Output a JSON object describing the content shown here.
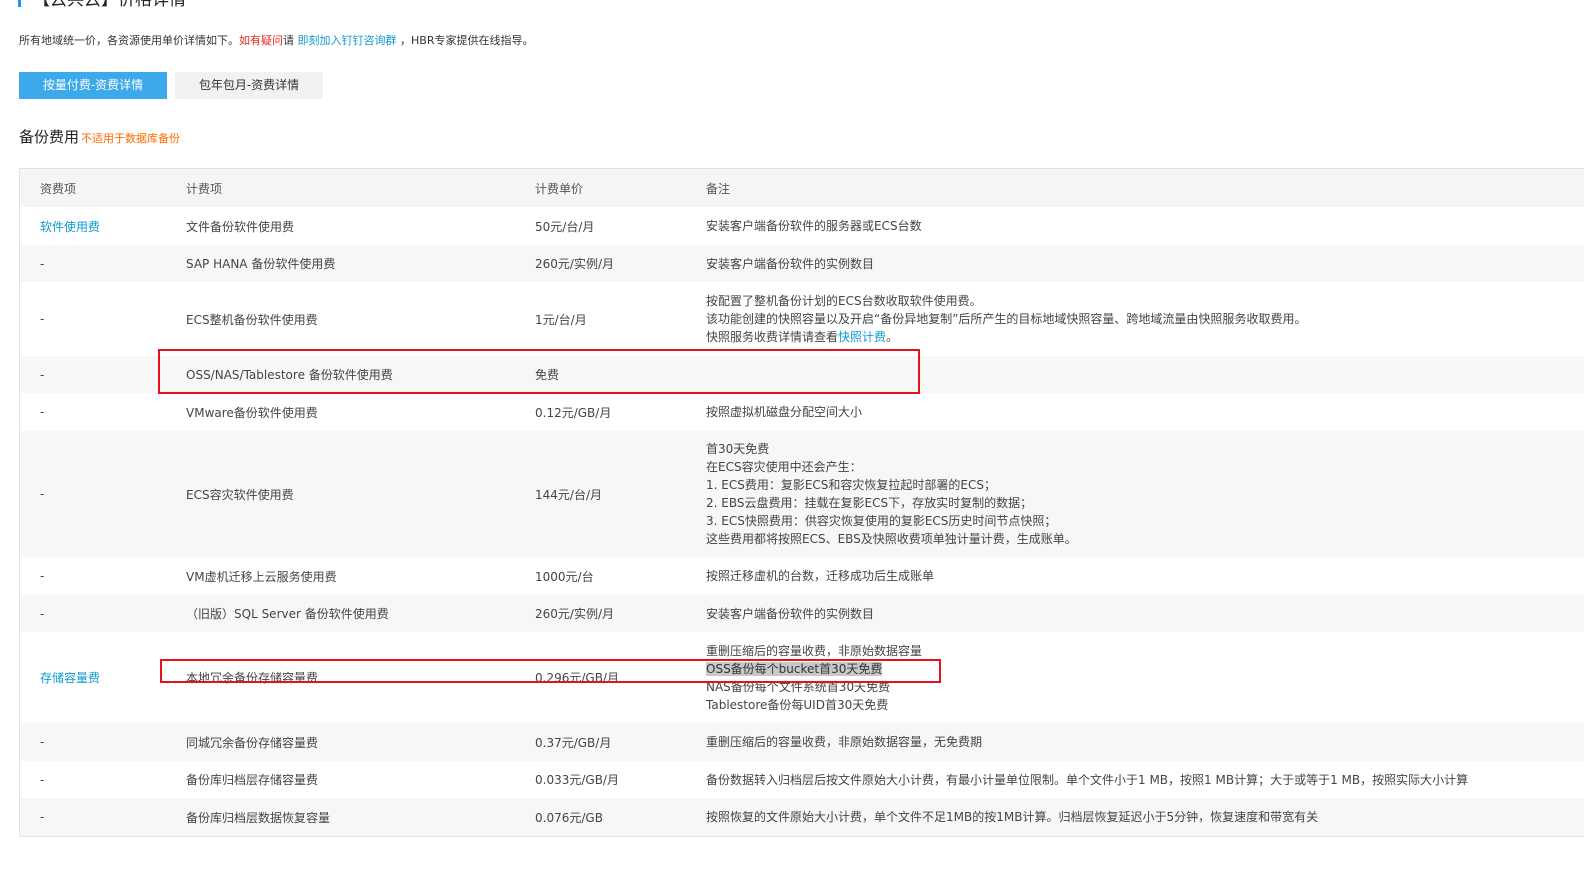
{
  "page": {
    "title": "【云共云】价格详情",
    "intro": {
      "text1": "所有地域统一价，各资源使用单价详情如下。",
      "red": "如有疑问",
      "text2": "请 ",
      "link": "即刻加入钉钉咨询群",
      "text3": " ，HBR专家提供在线指导。"
    },
    "tabs": [
      {
        "label": "按量付费-资费详情",
        "active": true
      },
      {
        "label": "包年包月-资费详情",
        "active": false
      }
    ],
    "section": {
      "title": "备份费用",
      "note": "不适用于数据库备份"
    }
  },
  "table": {
    "headers": [
      "资费项",
      "计费项",
      "计费单价",
      "备注"
    ],
    "rows": [
      {
        "category": "软件使用费",
        "item": "文件备份软件使用费",
        "price": "50元/台/月",
        "notes": [
          "安装客户端备份软件的服务器或ECS台数"
        ]
      },
      {
        "category": "-",
        "item": "SAP HANA 备份软件使用费",
        "price": "260元/实例/月",
        "notes": [
          "安装客户端备份软件的实例数目"
        ]
      },
      {
        "category": "-",
        "item": "ECS整机备份软件使用费",
        "price": "1元/台/月",
        "notes": [
          "按配置了整机备份计划的ECS台数收取软件使用费。",
          "该功能创建的快照容量以及开启“备份异地复制”后所产生的目标地域快照容量、跨地域流量由快照服务收取费用。"
        ],
        "note_tail_prefix": "快照服务收费详情请查看",
        "note_tail_link": "快照计费",
        "note_tail_suffix": "。"
      },
      {
        "category": "-",
        "item": "OSS/NAS/Tablestore 备份软件使用费",
        "price": "免费",
        "notes": []
      },
      {
        "category": "-",
        "item": "VMware备份软件使用费",
        "price": "0.12元/GB/月",
        "notes": [
          "按照虚拟机磁盘分配空间大小"
        ]
      },
      {
        "category": "-",
        "item": "ECS容灾软件使用费",
        "price": "144元/台/月",
        "notes": [
          "首30天免费",
          "在ECS容灾使用中还会产生：",
          "1. ECS费用：复影ECS和容灾恢复拉起时部署的ECS；",
          "2. EBS云盘费用：挂载在复影ECS下，存放实时复制的数据；",
          "3. ECS快照费用：供容灾恢复使用的复影ECS历史时间节点快照；",
          "这些费用都将按照ECS、EBS及快照收费项单独计量计费，生成账单。"
        ]
      },
      {
        "category": "-",
        "item": "VM虚机迁移上云服务使用费",
        "price": "1000元/台",
        "notes": [
          "按照迁移虚机的台数，迁移成功后生成账单"
        ]
      },
      {
        "category": "-",
        "item": "（旧版）SQL Server 备份软件使用费",
        "price": "260元/实例/月",
        "notes": [
          "安装客户端备份软件的实例数目"
        ]
      },
      {
        "category": "存储容量费",
        "item": "本地冗余备份存储容量费",
        "price": "0.296元/GB/月",
        "notes": [
          "重删压缩后的容量收费，非原始数据容量",
          "OSS备份每个bucket首30天免费",
          "NAS备份每个文件系统首30天免费",
          "Tablestore备份每UID首30天免费"
        ]
      },
      {
        "category": "-",
        "item": "同城冗余备份存储容量费",
        "price": "0.37元/GB/月",
        "notes": [
          "重删压缩后的容量收费，非原始数据容量，无免费期"
        ]
      },
      {
        "category": "-",
        "item": "备份库归档层存储容量费",
        "price": "0.033元/GB/月",
        "notes": [
          "备份数据转入归档层后按文件原始大小计费，有最小计量单位限制。单个文件小于1 MB，按照1 MB计算；大于或等于1 MB，按照实际大小计算"
        ]
      },
      {
        "category": "-",
        "item": "备份库归档层数据恢复容量",
        "price": "0.076元/GB",
        "notes": [
          "按照恢复的文件原始大小计费，单个文件不足1MB的按1MB计算。归档层恢复延迟小于5分钟，恢复速度和带宽有关"
        ]
      }
    ]
  }
}
